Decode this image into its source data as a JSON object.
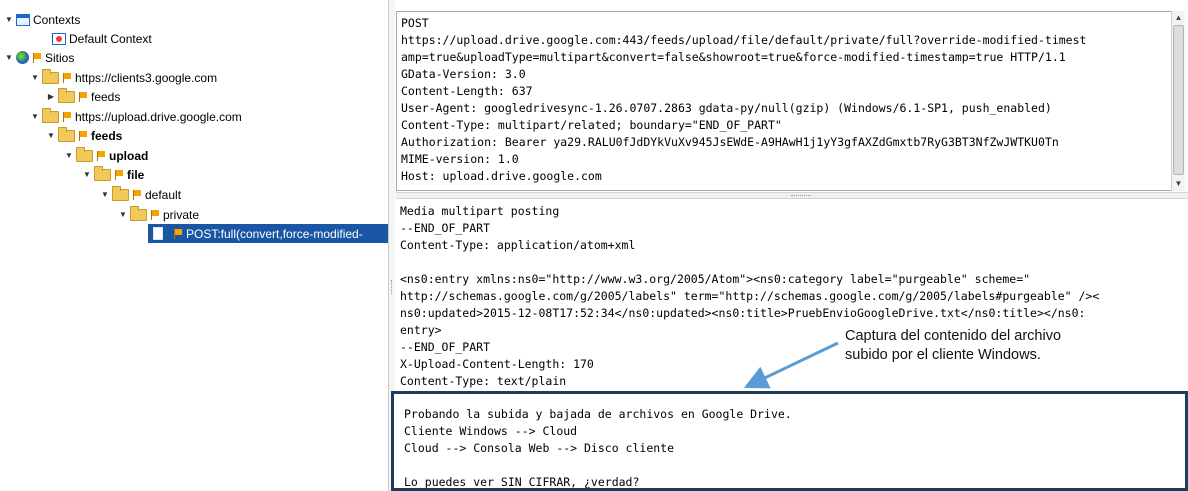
{
  "tree": {
    "contexts": "Contexts",
    "default_context": "Default Context",
    "sitios": "Sitios",
    "site1": "https://clients3.google.com",
    "site1_feeds": "feeds",
    "site2": "https://upload.drive.google.com",
    "site2_feeds": "feeds",
    "upload": "upload",
    "file": "file",
    "default": "default",
    "private": "private",
    "selected_request": "POST:full(convert,force-modified-"
  },
  "request_headers": {
    "lines": [
      "POST",
      "https://upload.drive.google.com:443/feeds/upload/file/default/private/full?override-modified-timest",
      "amp=true&uploadType=multipart&convert=false&showroot=true&force-modified-timestamp=true HTTP/1.1",
      "GData-Version: 3.0",
      "Content-Length: 637",
      "User-Agent: googledrivesync-1.26.0707.2863 gdata-py/null(gzip) (Windows/6.1-SP1, push_enabled)",
      "Content-Type: multipart/related; boundary=\"END_OF_PART\"",
      "Authorization: Bearer ya29.RALU0fJdDYkVuXv945JsEWdE-A9HAwH1j1yY3gfAXZdGmxtb7RyG3BT3NfZwJWTKU0Tn",
      "MIME-version: 1.0",
      "Host: upload.drive.google.com"
    ]
  },
  "request_body": {
    "lines": [
      "Media multipart posting",
      "--END_OF_PART",
      "Content-Type: application/atom+xml",
      "",
      "<ns0:entry xmlns:ns0=\"http://www.w3.org/2005/Atom\"><ns0:category label=\"purgeable\" scheme=\"",
      "http://schemas.google.com/g/2005/labels\" term=\"http://schemas.google.com/g/2005/labels#purgeable\" /><",
      "ns0:updated>2015-12-08T17:52:34</ns0:updated><ns0:title>PruebEnvioGoogleDrive.txt</ns0:title></ns0:",
      "entry>",
      "--END_OF_PART",
      "X-Upload-Content-Length: 170",
      "Content-Type: text/plain"
    ]
  },
  "captured_content": {
    "lines": [
      "Probando la subida y bajada de archivos en Google Drive.",
      "Cliente Windows --> Cloud",
      "Cloud --> Consola Web --> Disco cliente",
      "",
      "Lo puedes ver SIN CIFRAR, ¿verdad?"
    ]
  },
  "annotation": {
    "line1": "Captura del contenido del archivo",
    "line2": "subido por el cliente Windows."
  },
  "colors": {
    "selection": "#1a56a4",
    "highlight_border": "#1f3c5a",
    "arrow": "#5b9bd5"
  }
}
